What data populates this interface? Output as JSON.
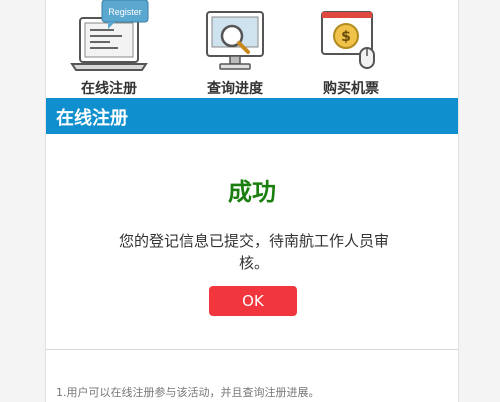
{
  "nav": {
    "items": [
      {
        "label": "在线注册",
        "icon": "laptop-register-icon",
        "badge": "Register"
      },
      {
        "label": "查询进度",
        "icon": "monitor-magnifier-icon"
      },
      {
        "label": "购买机票",
        "icon": "dollar-screen-mouse-icon"
      }
    ]
  },
  "section": {
    "title": "在线注册"
  },
  "dialog": {
    "title": "成功",
    "message": "您的登记信息已提交，待南航工作人员审核。",
    "ok_label": "OK"
  },
  "footer": {
    "note": "1.用户可以在线注册参与该活动，并且查询注册进展。"
  },
  "colors": {
    "accent": "#0f8fcd",
    "success": "#1a7f0e",
    "button": "#f2363d"
  }
}
